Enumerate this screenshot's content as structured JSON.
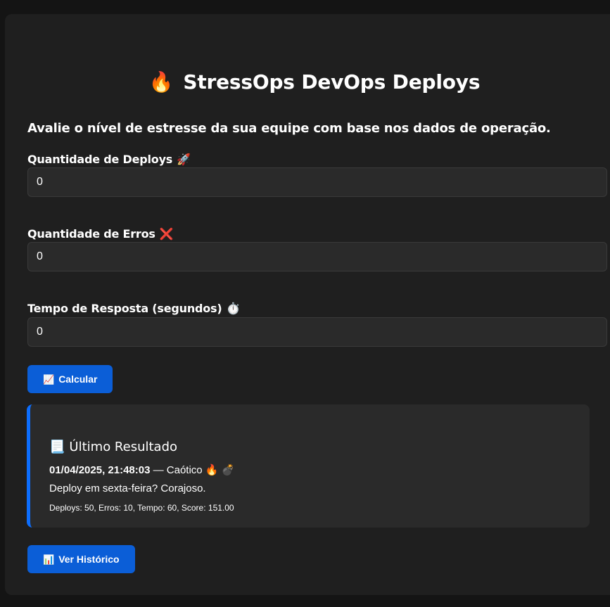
{
  "header": {
    "title_icon": "🔥",
    "title": "StressOps DevOps Deploys",
    "subtitle": "Avalie o nível de estresse da sua equipe com base nos dados de operação."
  },
  "form": {
    "deploys": {
      "label": "Quantidade de Deploys",
      "icon": "🚀",
      "value": "0"
    },
    "erros": {
      "label": "Quantidade de Erros",
      "icon": "❌",
      "value": "0"
    },
    "tempo": {
      "label": "Tempo de Resposta (segundos)",
      "icon": "⏱️",
      "value": "0"
    },
    "calc_button": {
      "icon": "📈",
      "label": "Calcular"
    }
  },
  "result": {
    "icon": "📃",
    "title": "Último Resultado",
    "timestamp": "01/04/2025, 21:48:03",
    "level": "— Caótico",
    "level_icons": "🔥 💣",
    "message": "Deploy em sexta-feira? Corajoso.",
    "details": "Deploys: 50, Erros: 10, Tempo: 60, Score: 151.00"
  },
  "history_button": {
    "icon": "📊",
    "label": "Ver Histórico"
  },
  "colors": {
    "page_bg": "#141414",
    "card_bg": "#1f1f1f",
    "input_bg": "#2a2a2a",
    "accent": "#0b5ed7",
    "text": "#ffffff"
  }
}
